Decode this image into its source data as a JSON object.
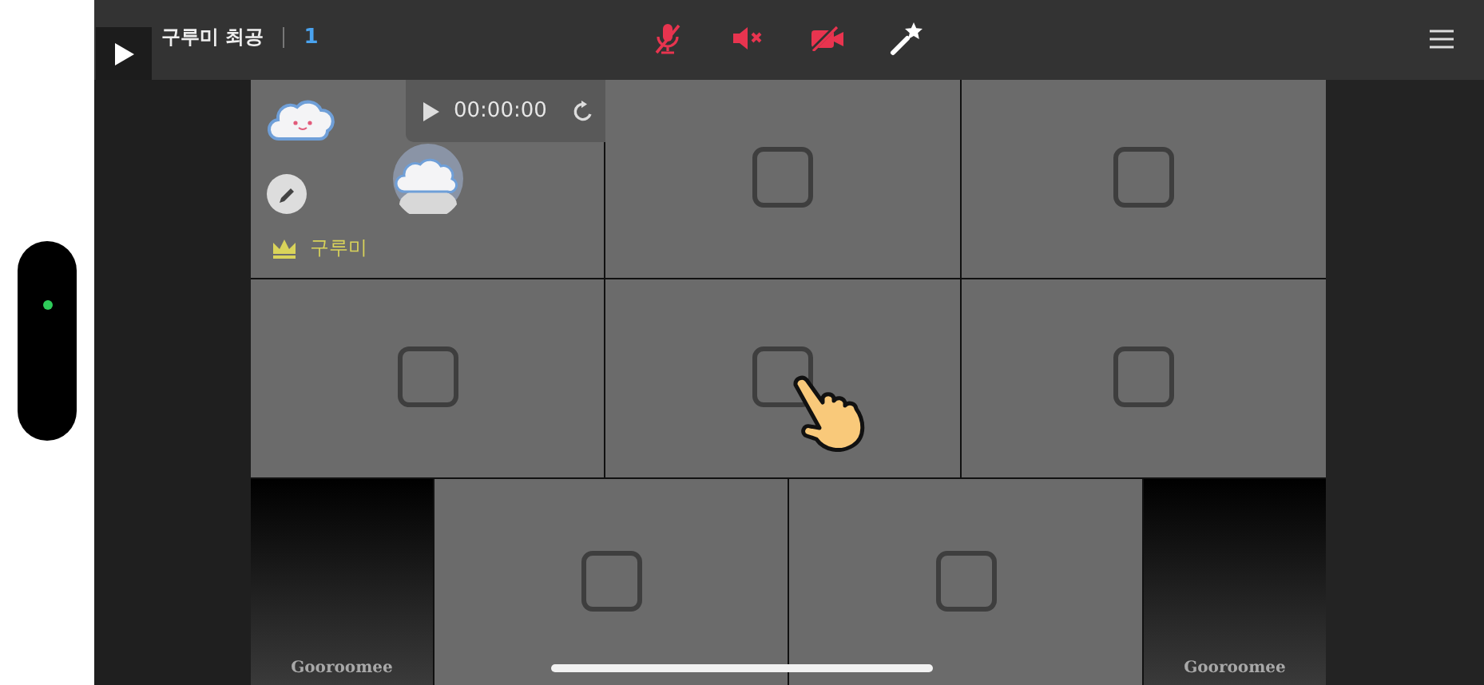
{
  "header": {
    "room_title": "구루미 최공",
    "participant_count": "1"
  },
  "player": {
    "time": "00:00:00"
  },
  "rows": [
    {
      "tiles": [
        {
          "kind": "host",
          "name": "구루미"
        },
        {
          "kind": "empty"
        },
        {
          "kind": "empty"
        }
      ]
    },
    {
      "tiles": [
        {
          "kind": "empty"
        },
        {
          "kind": "empty",
          "pointer": true
        },
        {
          "kind": "empty"
        }
      ]
    },
    {
      "tiles": [
        {
          "kind": "brand",
          "label": "Gooroomee"
        },
        {
          "kind": "empty"
        },
        {
          "kind": "empty"
        },
        {
          "kind": "brand",
          "label": "Gooroomee"
        }
      ]
    }
  ]
}
